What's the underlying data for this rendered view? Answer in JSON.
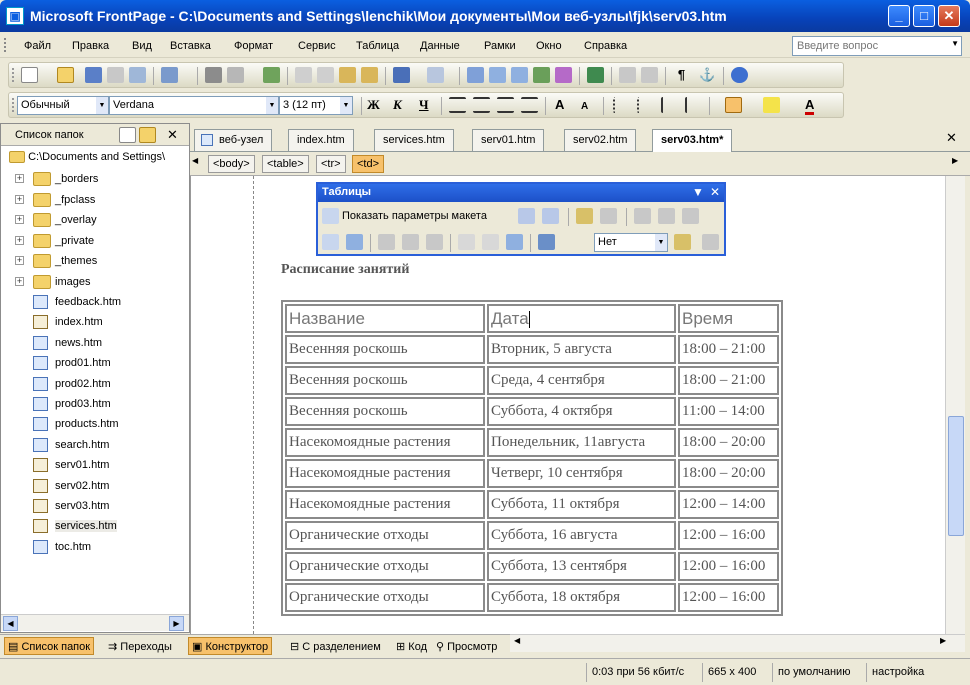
{
  "window": {
    "title": "Microsoft FrontPage - C:\\Documents and Settings\\lenchik\\Мои документы\\Мои веб-узлы\\fjk\\serv03.htm"
  },
  "menu": [
    "Файл",
    "Правка",
    "Вид",
    "Вставка",
    "Формат",
    "Сервис",
    "Таблица",
    "Данные",
    "Рамки",
    "Окно",
    "Справка"
  ],
  "ask_placeholder": "Введите вопрос",
  "format_toolbar": {
    "style": "Обычный",
    "font": "Verdana",
    "size": "3 (12 пт)",
    "bold": "Ж",
    "italic": "К",
    "underline": "Ч",
    "grow": "A",
    "shrink": "A",
    "font_color": "A"
  },
  "folder_pane": {
    "title": "Список папок",
    "root": "C:\\Documents and Settings\\",
    "folders": [
      "_borders",
      "_fpclass",
      "_overlay",
      "_private",
      "_themes",
      "images"
    ],
    "files": [
      "feedback.htm",
      "index.htm",
      "news.htm",
      "prod01.htm",
      "prod02.htm",
      "prod03.htm",
      "products.htm",
      "search.htm",
      "serv01.htm",
      "serv02.htm",
      "serv03.htm",
      "services.htm",
      "toc.htm"
    ]
  },
  "doc_tabs": [
    "веб-узел",
    "index.htm",
    "services.htm",
    "serv01.htm",
    "serv02.htm",
    "serv03.htm*"
  ],
  "breadcrumbs": [
    "<body>",
    "<table>",
    "<tr>",
    "<td>"
  ],
  "tables_toolbar": {
    "title": "Таблицы",
    "show_layout": "Показать параметры макета",
    "fill_value": "Нет"
  },
  "page": {
    "heading": "Расписание занятий",
    "table": {
      "headers": [
        "Название",
        "Дата",
        "Время"
      ],
      "rows": [
        [
          "Весенняя роскошь",
          "Вторник, 5 августа",
          "18:00 – 21:00"
        ],
        [
          "Весенняя роскошь",
          "Среда, 4 сентября",
          "18:00 – 21:00"
        ],
        [
          "Весенняя роскошь",
          "Суббота, 4 октября",
          "11:00 – 14:00"
        ],
        [
          "Насекомоядные растения",
          "Понедельник, 11августа",
          "18:00 – 20:00"
        ],
        [
          "Насекомоядные растения",
          "Четверг, 10 сентября",
          "18:00 – 20:00"
        ],
        [
          "Насекомоядные растения",
          "Суббота, 11 октября",
          "12:00 – 14:00"
        ],
        [
          "Органические отходы",
          "Суббота, 16 августа",
          "12:00 – 16:00"
        ],
        [
          "Органические отходы",
          "Суббота, 13 сентября",
          "12:00 – 16:00"
        ],
        [
          "Органические отходы",
          "Суббота, 18 октября",
          "12:00 – 16:00"
        ]
      ]
    }
  },
  "view_bar": {
    "folder_list": "Список папок",
    "navigation": "Переходы",
    "design": "Конструктор",
    "split": "С разделением",
    "code": "Код",
    "preview": "Просмотр"
  },
  "status": {
    "speed": "0:03 при 56 кбит/с",
    "size": "665 x 400",
    "default": "по умолчанию",
    "custom": "настройка"
  },
  "colors": {
    "accent": "#0a5fe0",
    "active_tab": "#f7c16b",
    "chrome": "#ece9d8"
  }
}
